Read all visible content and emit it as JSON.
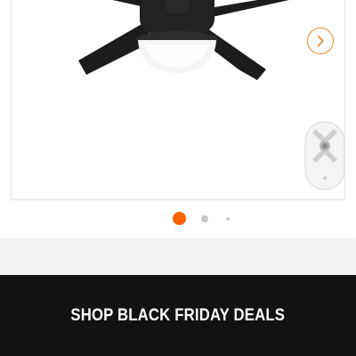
{
  "product_gallery": {
    "image_subject": "ceiling-fan-with-light",
    "thumbnail_subject": "remote-control",
    "next_icon": "chevron-right-icon",
    "pagination": {
      "total": 3,
      "active": 1
    }
  },
  "banner": {
    "label": "SHOP BLACK FRIDAY DEALS",
    "background": "#121212",
    "text_color": "#ffffff"
  },
  "colors": {
    "accent": "#f96302",
    "inactive_dot": "#c8c8c8",
    "page_background": "#f3f3f3"
  }
}
